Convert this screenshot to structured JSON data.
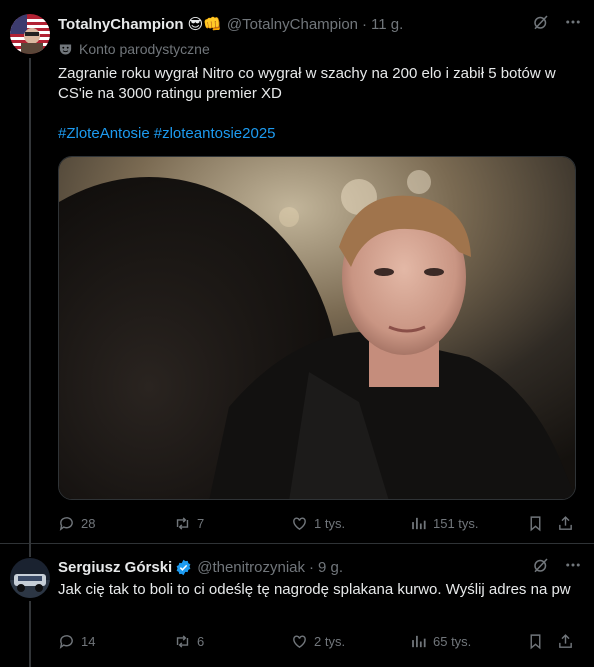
{
  "tweets": [
    {
      "author": "TotalnyChampion",
      "author_emojis": "😎👊",
      "handle": "@TotalnyChampion",
      "time": "11 g.",
      "parody_label": "Konto parodystyczne",
      "text": "Zagranie roku wygrał Nitro co wygrał w szachy na 200 elo i zabił 5 botów w CS'ie na 3000 ratingu premier XD",
      "hashtags": [
        "#ZloteAntosie",
        "#zloteantosie2025"
      ],
      "stats": {
        "replies": "28",
        "reposts": "7",
        "likes": "1 tys.",
        "views": "151 tys."
      }
    },
    {
      "author": "Sergiusz Górski",
      "handle": "@thenitrozyniak",
      "time": "9 g.",
      "text": "Jak cię tak to boli to ci odeślę tę nagrodę splakana kurwo. Wyślij adres na pw",
      "stats": {
        "replies": "14",
        "reposts": "6",
        "likes": "2 tys.",
        "views": "65 tys."
      }
    }
  ],
  "separator": "·",
  "colors": {
    "background": "#000000",
    "text": "#e7e9ea",
    "muted": "#71767b",
    "link": "#1d9bf0",
    "border": "#2f3336",
    "verified": "#1d9bf0"
  },
  "icons": [
    "grok-icon",
    "more-icon",
    "parody-mask-icon",
    "reply-icon",
    "repost-icon",
    "like-icon",
    "views-icon",
    "bookmark-icon",
    "share-icon",
    "verified-badge-icon"
  ]
}
